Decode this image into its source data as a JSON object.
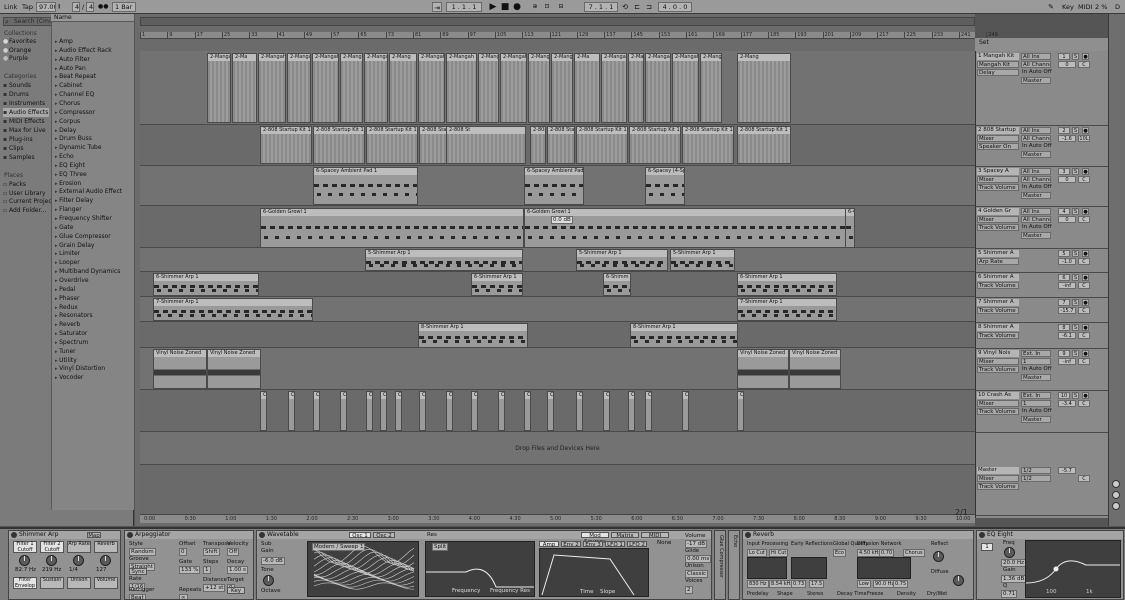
{
  "transport": {
    "link": "Link",
    "tap": "Tap",
    "tempo": "97.00",
    "sig_num": "4",
    "sig_sep": "/",
    "sig_den": "4",
    "quant": "1 Bar",
    "position": "1 . 1 . 1",
    "loop_start": "7 . 1 . 1",
    "loop_len": "4 . 0 . 0",
    "key": "Key",
    "midi": "MIDI",
    "cpu": "2 %",
    "d": "D"
  },
  "browser": {
    "search_placeholder": "Search (Cmd + F)",
    "collections_head": "Collections",
    "collections": [
      "Favorites",
      "Orange",
      "Purple"
    ],
    "collection_colors": [
      "#d9d9d9",
      "#cfcfcf",
      "#bdbdbd"
    ],
    "categories_head": "Categories",
    "categories": [
      "Sounds",
      "Drums",
      "Instruments",
      "Audio Effects",
      "MIDI Effects",
      "Max for Live",
      "Plug-ins",
      "Clips",
      "Samples"
    ],
    "places_head": "Places",
    "places": [
      "Packs",
      "User Library",
      "Current Project",
      "Add Folder..."
    ],
    "name_head": "Name",
    "devices": [
      "Amp",
      "Audio Effect Rack",
      "Auto Filter",
      "Auto Pan",
      "Beat Repeat",
      "Cabinet",
      "Channel EQ",
      "Chorus",
      "Compressor",
      "Corpus",
      "Delay",
      "Drum Buss",
      "Dynamic Tube",
      "Echo",
      "EQ Eight",
      "EQ Three",
      "Erosion",
      "External Audio Effect",
      "Filter Delay",
      "Flanger",
      "Frequency Shifter",
      "Gate",
      "Glue Compressor",
      "Grain Delay",
      "Limiter",
      "Looper",
      "Multiband Dynamics",
      "Overdrive",
      "Pedal",
      "Phaser",
      "Redux",
      "Resonators",
      "Reverb",
      "Saturator",
      "Spectrum",
      "Tuner",
      "Utility",
      "Vinyl Distortion",
      "Vocoder"
    ]
  },
  "ruler": {
    "bars": [
      "1",
      "9",
      "17",
      "25",
      "33",
      "41",
      "49",
      "57",
      "65",
      "73",
      "81",
      "89",
      "97",
      "105",
      "113",
      "121",
      "129",
      "137",
      "145",
      "153",
      "161",
      "169",
      "177",
      "185",
      "193",
      "201",
      "209",
      "217",
      "225",
      "233",
      "241",
      "249"
    ],
    "times": [
      "0:00",
      "0:30",
      "1:00",
      "1:30",
      "2:00",
      "2:30",
      "3:00",
      "3:30",
      "4:00",
      "4:30",
      "5:00",
      "5:30",
      "6:00",
      "6:30",
      "7:00",
      "7:30",
      "8:00",
      "8:30",
      "9:00",
      "9:30",
      "10:00"
    ],
    "page": "2/1"
  },
  "clips": {
    "mangah": [
      "2-Mangah",
      "2-Ma",
      "2-Mangah",
      "2-Mangah Kit",
      "2-Mangah Kit 1",
      "2-Mangah Kit 1",
      "2-Mangah Kit",
      "2-Mang",
      "2-Mangah",
      "2-Mangah",
      "2-Mangah Kit 1",
      "2-Mangah Kit 1",
      "2-Mangah Kit 1"
    ],
    "startup": [
      "2-808 Startup Kit 1",
      "2-808 Startup Kit 1",
      "2-808 Startup Kit 1",
      "2-808 Startup Kit 1",
      "2-808 St",
      "2-808 Star",
      "2-808 Startup Kit 1"
    ],
    "pad": [
      "6-Spacey Ambient Pad 1",
      "6-Spacey Ambient Pad 1",
      "6-Spacey (4-Sp"
    ],
    "growl": [
      "6-Golden Growl 1",
      "6-Golden Growl 1",
      "6-Go"
    ],
    "gain_label": "0.0 dB",
    "arp5": [
      "5-Shimmer Arp 1",
      "5-Shimmer Arp 1",
      "5-Shimmer Arp 1"
    ],
    "arp6": [
      "6-Shimmer Arp 1",
      "6-Shimmer Arp 1",
      "6-Shimm",
      "6-Shimmer Arp 1"
    ],
    "arp7": [
      "7-Shimmer Arp 1",
      "7-Shimmer Arp 1"
    ],
    "arp8": [
      "8-Shimmer Arp 1",
      "8-Shimmer Arp 1"
    ],
    "vinyl": [
      "Vinyl Noise Zoned",
      "Vinyl Noise Zoned",
      "Vinyl Noise Zoned",
      "Vinyl Noise Zoned"
    ],
    "crash": "Cr"
  },
  "drop_msg": "Drop Files and Devices Here",
  "mixer": {
    "set_label": "Set",
    "tracks": [
      {
        "name": "1 Mangah Kit",
        "dd1": "Mangah Kit",
        "dd2": "Delay",
        "in": "All Ins",
        "ch": "All Channe",
        "mon": "In Auto Off",
        "out": "Master",
        "num": "1",
        "vol": "0",
        "pan": "C",
        "extra": "S"
      },
      {
        "name": "2 808 Startup",
        "dd1": "Mixer",
        "dd2": "Speaker On",
        "in": "All Ins",
        "ch": "All Channe",
        "mon": "In Auto Off",
        "out": "Master",
        "num": "2",
        "vol": "-1.6",
        "pan": "10L",
        "extra": "S"
      },
      {
        "name": "3 Spacey A",
        "dd1": "Mixer",
        "dd2": "Track Volume",
        "in": "All Ins",
        "ch": "All Channe",
        "mon": "In Auto Off",
        "out": "Master",
        "num": "3",
        "vol": "0",
        "pan": "C",
        "extra": "S"
      },
      {
        "name": "4 Golden Gr",
        "dd1": "Mixer",
        "dd2": "Track Volume",
        "in": "All Ins",
        "ch": "All Channe",
        "mon": "In Auto Off",
        "out": "Master",
        "num": "4",
        "vol": "0",
        "pan": "C",
        "extra": "S"
      },
      {
        "name": "5 Shimmer A",
        "dd1": "Arp Rate",
        "dd2": "",
        "in": "",
        "ch": "",
        "mon": "",
        "out": "",
        "num": "5",
        "vol": "-1.0",
        "pan": "C",
        "extra": "S"
      },
      {
        "name": "6 Shimmer A",
        "dd1": "Track Volume",
        "dd2": "",
        "in": "",
        "ch": "",
        "mon": "",
        "out": "",
        "num": "6",
        "vol": "-inf",
        "pan": "C",
        "extra": "S"
      },
      {
        "name": "7 Shimmer A",
        "dd1": "Track Volume",
        "dd2": "",
        "in": "",
        "ch": "",
        "mon": "",
        "out": "",
        "num": "7",
        "vol": "-15.7",
        "pan": "C",
        "extra": "S"
      },
      {
        "name": "8 Shimmer A",
        "dd1": "Track Volume",
        "dd2": "",
        "in": "",
        "ch": "",
        "mon": "",
        "out": "",
        "num": "8",
        "vol": "-6.1",
        "pan": "C",
        "extra": "S"
      },
      {
        "name": "9 Vinyl Nois",
        "dd1": "Mixer",
        "dd2": "Track Volume",
        "in": "Ext. In",
        "ch": "1",
        "mon": "In Auto Off",
        "out": "Master",
        "num": "9",
        "vol": "-inf",
        "pan": "C",
        "extra": "S"
      },
      {
        "name": "10 Crash As",
        "dd1": "Mixer",
        "dd2": "Track Volume",
        "in": "Ext. In",
        "ch": "1",
        "mon": "In Auto Off",
        "out": "Master",
        "num": "10",
        "vol": "-3.4",
        "pan": "C",
        "extra": "S"
      }
    ],
    "master": {
      "name": "Master",
      "dd1": "Mixer",
      "dd2": "Track Volume",
      "in": "1/2",
      "ch": "1/2",
      "vol": "-5.7",
      "pan": "C"
    }
  },
  "devices_chain": {
    "shimmer_arp": {
      "title": "Shimmer Arp",
      "map": "Map",
      "macros": [
        "Filter 1 Cutoff",
        "Filter 2 Cutoff",
        "Arp Rate",
        "Reverb"
      ],
      "vals": [
        "82.7 Hz",
        "219 Hz",
        "1/4",
        "127"
      ],
      "row2": [
        "Filter Envelop",
        "Sustain",
        "Unison",
        "Volume"
      ]
    },
    "arpeggiator": {
      "title": "Arpeggiator",
      "labels": [
        "Style",
        "Groove",
        "Offset",
        "Rate",
        "Gate",
        "Transpose",
        "Steps",
        "Velocity",
        "Decay",
        "Target",
        "Retrigger",
        "Repeats",
        "Distance"
      ],
      "vals": [
        "Random",
        "Straight",
        "0",
        "1/16",
        "133 %",
        "Shift",
        "1",
        "Off",
        "1.00 s",
        "0",
        "Beat",
        "∞",
        "+12 st"
      ],
      "sync": "Sync",
      "key": "Key"
    },
    "wavetable": {
      "title": "Wavetable",
      "tabs": [
        "Osc 1",
        "Osc 2"
      ],
      "sub": "Sub",
      "gain": "Gain",
      "gain_val": "-6.0 dB",
      "tone": "Tone",
      "octave": "Octave",
      "filter_type": "Modern / Sweep 1",
      "matrix_tabs": [
        "Mod Sources",
        "Matrix",
        "MIDI"
      ],
      "env_tabs": [
        "Amp",
        "Env 2",
        "Env 3",
        "LFO 1",
        "LFO 2"
      ],
      "freq": "Frequency",
      "freq_res": "Frequency Res",
      "res": "Res",
      "vol": "Volume",
      "vol_val": "-17 dB",
      "glide": "Glide",
      "glide_val": "0.00 ms",
      "unison": "Unison",
      "unison_val": "Classic",
      "voices": "Voices",
      "voices_val": "2",
      "none": "None",
      "time": "Time",
      "slope": "Slope",
      "split": "Split",
      "osc_val": "+0.0"
    },
    "glue": {
      "title": "Glue Compressor"
    },
    "echo": {
      "title": "Echo"
    },
    "reverb": {
      "title": "Reverb",
      "sections": [
        "Input Processing",
        "Early Reflections",
        "Global Quality",
        "Diffusion Network",
        "Reflect",
        "Diffuse"
      ],
      "vals": [
        "Lo Cut",
        "Hi Cut",
        "830 Hz",
        "8.54 kHz",
        "0.73",
        "17.5",
        "Eco",
        "4.50 kHz",
        "0.70",
        "Chorus",
        "Low",
        "90.0 Hz",
        "0.75"
      ],
      "bottom": [
        "Predelay",
        "Shape",
        "Stereo",
        "Decay Time",
        "Freeze",
        "Density",
        "Dry/Wet"
      ]
    },
    "eq": {
      "title": "EQ Eight",
      "freq": "Freq",
      "freq_val": "20.0 Hz",
      "gain": "Gain",
      "gain_val": "1.36 dB",
      "q": "Q",
      "q_val": "0.71",
      "mode": "1",
      "scale_labels": [
        "100",
        "1k"
      ]
    }
  }
}
